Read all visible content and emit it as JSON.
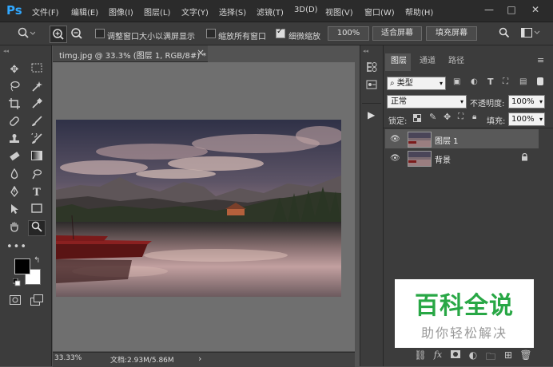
{
  "app": {
    "logo": "Ps"
  },
  "menu": [
    "文件(F)",
    "编辑(E)",
    "图像(I)",
    "图层(L)",
    "文字(Y)",
    "选择(S)",
    "滤镜(T)",
    "3D(D)",
    "视图(V)",
    "窗口(W)",
    "帮助(H)"
  ],
  "window_controls": {
    "minimize": "—",
    "maximize": "□",
    "close": "✕"
  },
  "options": {
    "resize_windows": "调整窗口大小以满屏显示",
    "resize_windows_checked": false,
    "zoom_all": "缩放所有窗口",
    "zoom_all_checked": false,
    "scrubby_zoom": "细微缩放",
    "scrubby_zoom_checked": true,
    "zoom_percent": "100%",
    "fit_screen": "适合屏幕",
    "fill_screen": "填充屏幕"
  },
  "document": {
    "tab_title": "timg.jpg @ 33.3% (图层 1, RGB/8#) *",
    "tab_close": "×",
    "zoom": "33.33%",
    "doc_info": "文档:2.93M/5.86M",
    "status_arrow": "›"
  },
  "layers_panel": {
    "tabs": [
      "图层",
      "通道",
      "路径"
    ],
    "filter_kind": "类型",
    "blend_mode": "正常",
    "opacity_label": "不透明度:",
    "opacity": "100%",
    "lock_label": "锁定:",
    "fill_label": "填充:",
    "fill": "100%",
    "layers": [
      {
        "name": "图层 1",
        "visible": true,
        "selected": true,
        "locked": false
      },
      {
        "name": "背景",
        "visible": true,
        "selected": false,
        "locked": true
      }
    ]
  },
  "watermark": {
    "title": "百科全说",
    "subtitle": "助你轻松解决"
  },
  "colors": {
    "accent": "#31a8ff",
    "foreground": "#000000",
    "background": "#ffffff",
    "watermark_green": "#28a745"
  }
}
